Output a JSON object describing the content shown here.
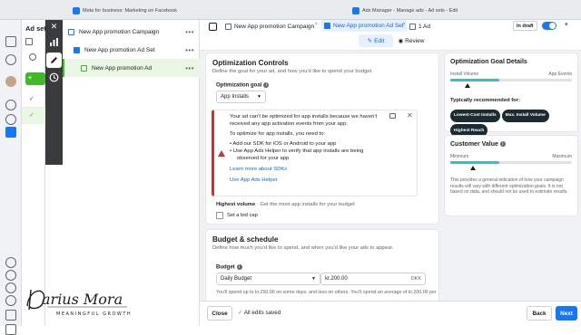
{
  "os_bar": {
    "tab_left": "Meta for business: Marketing on Facebook",
    "tab_right": "Ads Manager - Manage ads - Ad sets - Edit"
  },
  "ad_sets_panel": {
    "title": "Ad sets"
  },
  "tree": {
    "items": [
      {
        "label": "New App promotion Campaign",
        "color": "#1877f2"
      },
      {
        "label": "New App promotion Ad Set",
        "color": "#1877f2"
      },
      {
        "label": "New App promotion Ad",
        "color": "#42b72a"
      }
    ],
    "more_label": "•••"
  },
  "header": {
    "breadcrumb": [
      "New App promotion Campaign",
      "New App promotion Ad Set",
      "1 Ad"
    ],
    "status": "In draft",
    "tab_edit": "Edit",
    "tab_review": "Review"
  },
  "optimization": {
    "title": "Optimization Controls",
    "subtitle": "Define the goal for your ad, and how you'd like to spend your budget.",
    "goal_label": "Optimization goal",
    "goal_value": "App Installs",
    "notice": {
      "line1": "Your ad can't be optimized for app installs because we haven't",
      "line2": "received any app activation events from your app.",
      "line3": "To optimize for app installs, you need to:",
      "bullet1": "Add our SDK for iOS or Android to your app",
      "bullet2a": "Use App Ads Helper to verify that app installs are being",
      "bullet2b": "observed for your app",
      "link1": "Learn more about SDKs",
      "link2": "Use App Ads Helper"
    },
    "volume_label": "Highest volume",
    "volume_desc": " · Get the most app installs for your budget",
    "bid_cap": "Set a bid cap"
  },
  "budget": {
    "title": "Budget & schedule",
    "subtitle": "Define how much you'd like to spend, and when you'd like your ads to appear.",
    "label": "Budget",
    "type": "Daily Budget",
    "amount": "kr.200.00",
    "currency": "DKK",
    "note": "You'll spend up to kr.250.00 on some days, and less on others. You'll spend an average of kr.200.00 per"
  },
  "right_panel": {
    "goal_details_title": "Optimization Goal Details",
    "install_volume": "Install Volume",
    "app_events": "App Events",
    "recommended_title": "Typically recommended for:",
    "pills": [
      "Lowest-Cost Installs",
      "Max. Install Volume",
      "Highest Reach"
    ],
    "customer_value_title": "Customer Value",
    "minimum": "Minimum",
    "maximum": "Maximum",
    "description": "This provides a general indication of how your campaign results will vary with different optimization goals. It is not based on data, and should not be used to estimate results."
  },
  "footer": {
    "close": "Close",
    "saved": "All edits saved",
    "back": "Back",
    "next": "Next"
  },
  "signature": {
    "name": "Darius Mora",
    "tagline": "MEANINGFUL GROWTH"
  }
}
